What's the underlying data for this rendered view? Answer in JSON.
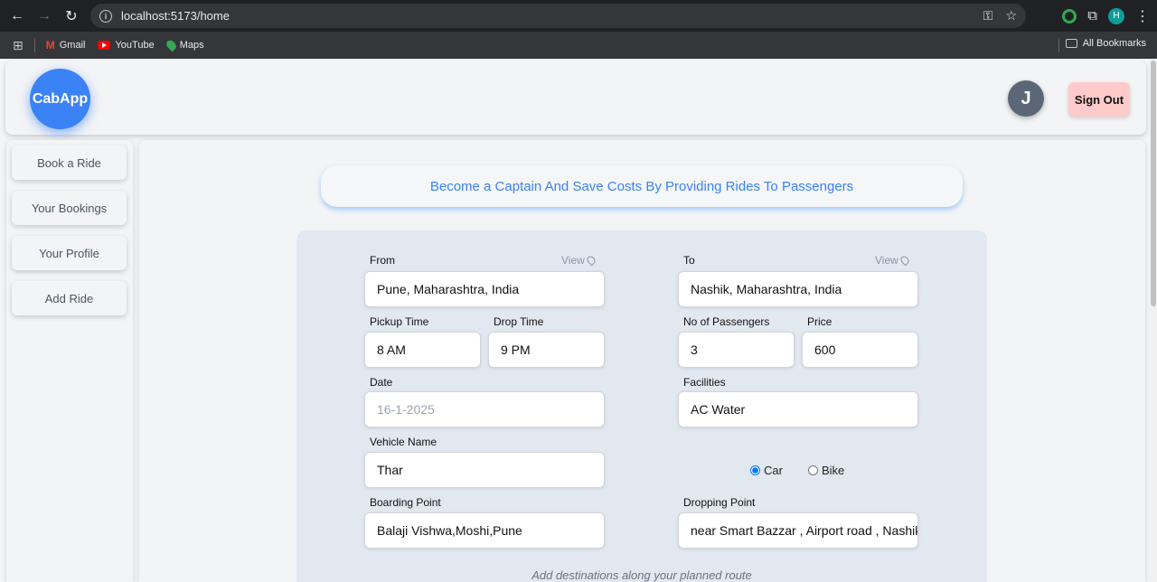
{
  "browser": {
    "url": "localhost:5173/home",
    "profile_initial": "H",
    "bookmarks": [
      {
        "label": "Gmail",
        "icon": "gmail-icon"
      },
      {
        "label": "YouTube",
        "icon": "youtube-icon"
      },
      {
        "label": "Maps",
        "icon": "maps-icon"
      }
    ],
    "all_bookmarks": "All Bookmarks"
  },
  "header": {
    "logo": "CabApp",
    "avatar_initial": "J",
    "signout_label": "Sign Out"
  },
  "sidebar": {
    "items": [
      {
        "label": "Book a Ride"
      },
      {
        "label": "Your Bookings"
      },
      {
        "label": "Your Profile"
      },
      {
        "label": "Add Ride"
      }
    ]
  },
  "main": {
    "banner": "Become a Captain And Save Costs By Providing Rides To Passengers",
    "form": {
      "from_label": "From",
      "from_view": "View",
      "from_value": "Pune, Maharashtra, India",
      "to_label": "To",
      "to_view": "View",
      "to_value": "Nashik, Maharashtra, India",
      "pickup_label": "Pickup Time",
      "pickup_value": "8 AM",
      "drop_label": "Drop Time",
      "drop_value": "9 PM",
      "passengers_label": "No of Passengers",
      "passengers_value": "3",
      "price_label": "Price",
      "price_value": "600",
      "date_label": "Date",
      "date_placeholder": "16-1-2025",
      "facilities_label": "Facilities",
      "facilities_value": "AC Water",
      "vehicle_label": "Vehicle Name",
      "vehicle_value": "Thar",
      "vehicle_types": [
        {
          "label": "Car",
          "checked": true
        },
        {
          "label": "Bike",
          "checked": false
        }
      ],
      "boarding_label": "Boarding Point",
      "boarding_value": "Balaji Vishwa,Moshi,Pune",
      "dropping_label": "Dropping Point",
      "dropping_value": "near Smart Bazzar , Airport road , Nashik",
      "footer_note": "Add destinations along your planned route"
    }
  },
  "colors": {
    "accent": "#3b82f6",
    "signout_bg": "#fecaca",
    "form_bg": "#e2e8f0"
  }
}
